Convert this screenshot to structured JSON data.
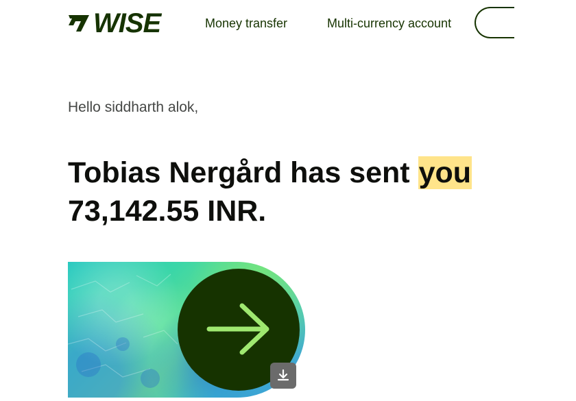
{
  "header": {
    "logo_text": "WISE",
    "nav": {
      "money_transfer": "Money transfer",
      "multi_currency": "Multi-currency account"
    }
  },
  "greeting": "Hello siddharth alok,",
  "headline": {
    "before": "Tobias Nergård has sent ",
    "highlight": "you",
    "amount_line": "73,142.55 INR."
  },
  "icons": {
    "logo": "wise-flag-icon",
    "hero_arrow": "arrow-right-icon",
    "download": "download-icon"
  },
  "colors": {
    "brand_dark": "#163300",
    "brand_green": "#9fe870",
    "highlight": "#ffe48a"
  }
}
